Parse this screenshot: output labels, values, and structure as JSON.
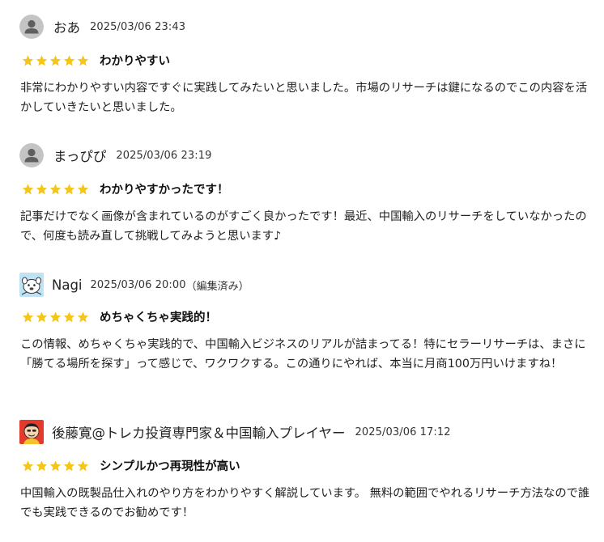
{
  "colors": {
    "star": "#F5C518",
    "avatar_bg": "#C4C4C4",
    "avatar_fg": "#5F5F5F"
  },
  "reviews": [
    {
      "avatar_icon": "default-user-icon",
      "name": "おあ",
      "date": "2025/03/06 23:43",
      "edited": "",
      "rating": 5,
      "title": "わかりやすい",
      "body": "非常にわかりやすい内容ですぐに実践してみたいと思いました。市場のリサーチは鍵になるのでこの内容を活かしていきたいと思いました。"
    },
    {
      "avatar_icon": "default-user-icon",
      "name": "まっぴぴ",
      "date": "2025/03/06 23:19",
      "edited": "",
      "rating": 5,
      "title": "わかりやすかったです！",
      "body": "記事だけでなく画像が含まれているのがすごく良かったです！最近、中国輸入のリサーチをしていなかったので、何度も読み直して挑戦してみようと思います♪"
    },
    {
      "avatar_icon": "cartoon-animal-avatar-icon",
      "name": "Nagi",
      "date": "2025/03/06 20:00",
      "edited": "（編集済み）",
      "rating": 5,
      "title": "めちゃくちゃ実践的！",
      "body": "この情報、めちゃくちゃ実践的で、中国輸入ビジネスのリアルが詰まってる！特にセラーリサーチは、まさに「勝てる場所を探す」って感じで、ワクワクする。この通りにやれば、本当に月商100万円いけますね！"
    },
    {
      "avatar_icon": "cartoon-person-avatar-icon",
      "name": "後藤寛@トレカ投資専門家＆中国輸入プレイヤー",
      "date": "2025/03/06 17:12",
      "edited": "",
      "rating": 5,
      "title": "シンプルかつ再現性が高い",
      "body": "中国輸入の既製品仕入れのやり方をわかりやすく解説しています。 無料の範囲でやれるリサーチ方法なので誰でも実践できるのでお勧めです！"
    }
  ]
}
